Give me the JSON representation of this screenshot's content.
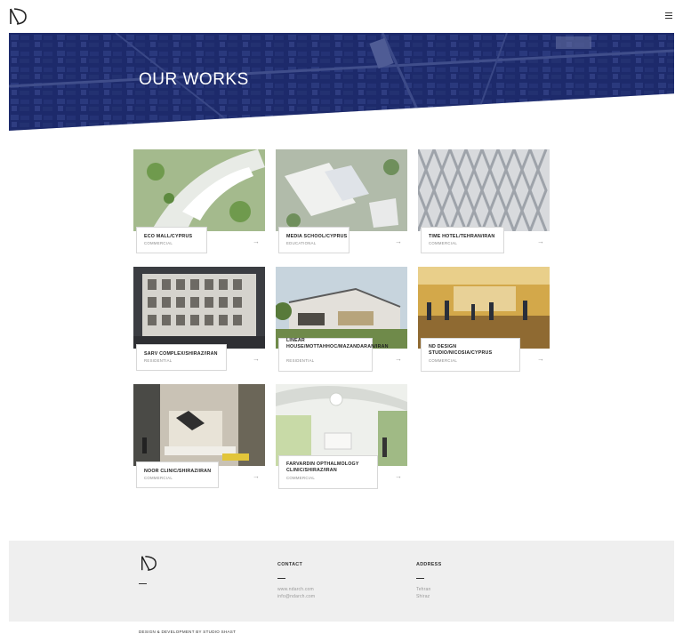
{
  "header": {
    "logo_icon": "nd-logo-icon",
    "menu_icon": "hamburger-menu-icon"
  },
  "hero": {
    "title": "OUR WORKS",
    "overlay_color": "#1c2a6e"
  },
  "projects": [
    {
      "title": "ECO MALL/CYPRUS",
      "category": "COMMERCIAL",
      "arrow": "→"
    },
    {
      "title": "MEDIA SCHOOL/CYPRUS",
      "category": "EDUCATIONAL",
      "arrow": "→"
    },
    {
      "title": "TIME HOTEL/TEHRAN/IRAN",
      "category": "COMMERCIAL",
      "arrow": "→"
    },
    {
      "title": "SARV COMPLEX/SHIRAZ/IRAN",
      "category": "RESIDENTIAL",
      "arrow": "→"
    },
    {
      "title": "LINEAR HOUSE/MOTTAHHOC/MAZANDARAN/IRAN",
      "category": "RESIDENTIAL",
      "arrow": "→"
    },
    {
      "title": "ND DESIGN STUDIO/NICOSIA/CYPRUS",
      "category": "COMMERCIAL",
      "arrow": "→"
    },
    {
      "title": "NOOR CLINIC/SHIRAZ/IRAN",
      "category": "COMMERCIAL",
      "arrow": "→"
    },
    {
      "title": "FARVARDIN OPTHALMOLOGY CLINIC/SHIRAZ/IRAN",
      "category": "COMMERCIAL",
      "arrow": "→"
    }
  ],
  "footer": {
    "contact_heading": "CONTACT",
    "contact_lines": [
      "www.ndarch.com",
      "info@ndarch.com"
    ],
    "address_heading": "ADDRESS",
    "address_lines": [
      "Tehran",
      "Shiraz"
    ],
    "credit": "DESIGN & DEVELOPMENT BY STUDIO SHAST"
  }
}
